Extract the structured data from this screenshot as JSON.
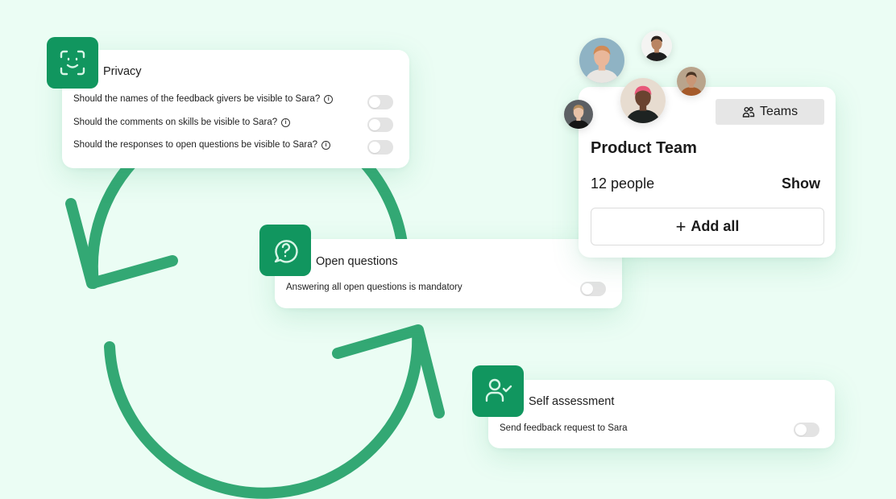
{
  "colors": {
    "background": "#EBFDF4",
    "accent_green": "#11965F",
    "arrow_green": "#33A874",
    "toggle_off": "#E3E3E3"
  },
  "cycle": {
    "icon": "refresh-cycle-arrows"
  },
  "privacy_card": {
    "icon": "face-id-icon",
    "title": "Privacy",
    "rows": [
      {
        "label": "Should the names of the feedback givers be visible to Sara?",
        "info_icon": true,
        "toggle_on": false
      },
      {
        "label": "Should the comments on skills be visible to Sara?",
        "info_icon": true,
        "toggle_on": false
      },
      {
        "label": "Should the responses to open questions be visible to Sara?",
        "info_icon": true,
        "toggle_on": false
      }
    ]
  },
  "open_questions_card": {
    "icon": "question-chat-icon",
    "title": "Open questions",
    "rows": [
      {
        "label": "Answering all open questions is mandatory",
        "toggle_on": false
      }
    ]
  },
  "self_assessment_card": {
    "icon": "user-check-icon",
    "title": "Self assessment",
    "rows": [
      {
        "label": "Send feedback request to Sara",
        "toggle_on": false
      }
    ]
  },
  "team_card": {
    "teams_button": {
      "icon": "users-icon",
      "label": "Teams"
    },
    "name": "Product Team",
    "count": "12 people",
    "show_label": "Show",
    "add_all": {
      "icon": "plus",
      "label": "Add all"
    },
    "avatars": [
      {
        "name": "avatar-1",
        "bg": "#8FB3C4",
        "skin": "#E9B79A",
        "hair": "#D28A55",
        "shirt": "#E9E6E2"
      },
      {
        "name": "avatar-2",
        "bg": "#F4F4F2",
        "skin": "#B98563",
        "hair": "#2A211C",
        "shirt": "#1E1E1E"
      },
      {
        "name": "avatar-3",
        "bg": "#B9A48C",
        "skin": "#C99676",
        "hair": "#4A3424",
        "shirt": "#A55A2A"
      },
      {
        "name": "avatar-4",
        "bg": "#E7DCD0",
        "skin": "#6A4330",
        "hair": "#E8587A",
        "shirt": "#1E2322"
      },
      {
        "name": "avatar-5",
        "bg": "#5C5F63",
        "skin": "#E8C2A8",
        "hair": "#B58C5C",
        "shirt": "#151515"
      }
    ]
  }
}
